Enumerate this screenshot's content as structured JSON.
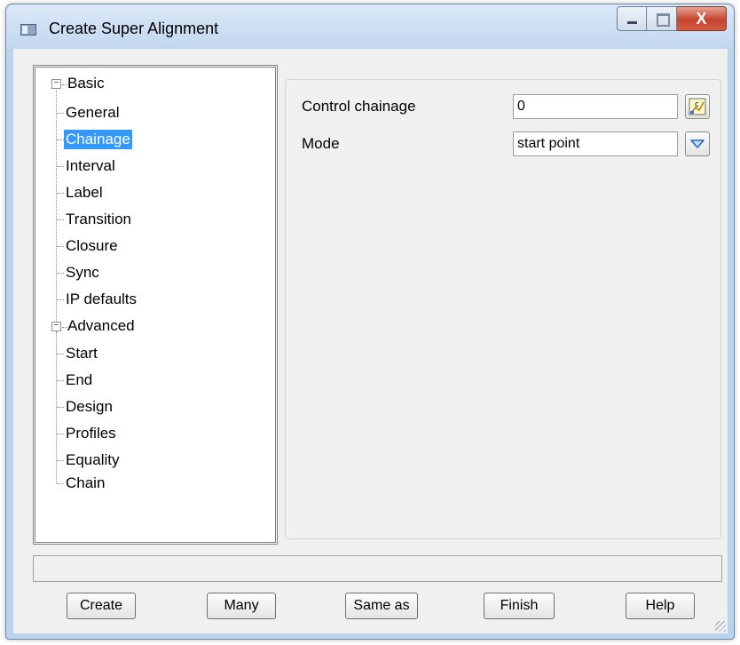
{
  "window": {
    "title": "Create Super Alignment",
    "close_glyph": "X"
  },
  "tree": {
    "basic": {
      "label": "Basic",
      "items": [
        "General",
        "Chainage",
        "Interval",
        "Label",
        "Transition",
        "Closure",
        "Sync",
        "IP defaults"
      ]
    },
    "advanced": {
      "label": "Advanced",
      "items": [
        "Start",
        "End",
        "Design",
        "Profiles",
        "Equality",
        "Chain"
      ]
    },
    "selected": "Chainage"
  },
  "form": {
    "control_chainage": {
      "label": "Control chainage",
      "value": "0"
    },
    "mode": {
      "label": "Mode",
      "value": "start point"
    }
  },
  "status_text": "",
  "buttons": {
    "create": "Create",
    "many": "Many",
    "same_as": "Same as",
    "finish": "Finish",
    "help": "Help"
  },
  "icons": {
    "chainage_picker": "chainage-pick-icon",
    "mode_dropdown": "chevron-down-icon"
  }
}
